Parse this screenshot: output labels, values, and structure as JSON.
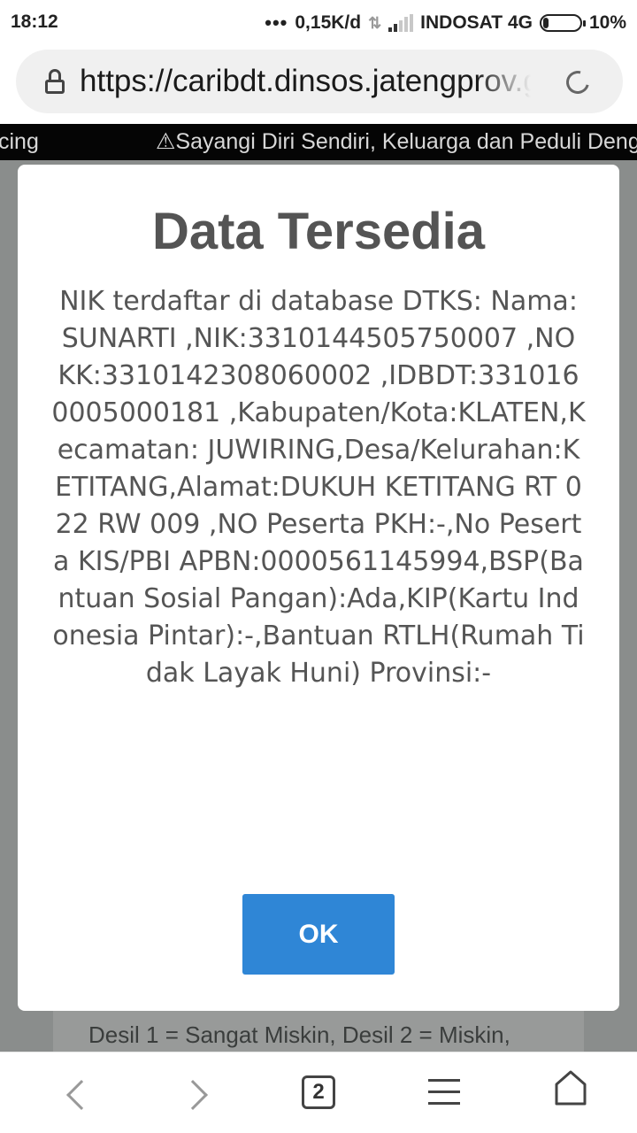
{
  "status_bar": {
    "time": "18:12",
    "network_speed": "0,15K/d",
    "carrier": "INDOSAT 4G",
    "battery": "10%"
  },
  "browser": {
    "url": "https://caribdt.dinsos.jatengprov.go.id",
    "tab_count": "2"
  },
  "page": {
    "marquee_left_fragment": "cing",
    "marquee_text": "Sayangi Diri Sendiri, Keluarga dan Peduli Dengan Sesama",
    "background_text": "Desil 1 = Sangat Miskin, Desil 2 = Miskin,"
  },
  "modal": {
    "title": "Data Tersedia",
    "body": "NIK terdaftar di database DTKS: Nama:SUNARTI ,NIK:3310144505750007 ,NO KK:3310142308060002 ,IDBDT:3310160005000181 ,Kabupaten/Kota:KLATEN,Kecamatan: JUWIRING,Desa/Kelurahan:KETITANG,Alamat:DUKUH KETITANG RT 022 RW 009 ,NO Peserta PKH:-,No Peserta KIS/PBI APBN:0000561145994,BSP(Bantuan Sosial Pangan):Ada,KIP(Kartu Indonesia Pintar):-,Bantuan RTLH(Rumah Tidak Layak Huni) Provinsi:-",
    "ok_label": "OK"
  },
  "colors": {
    "ok_button": "#2f86d6",
    "title_text": "#545454",
    "overlay": "#8a8d8c"
  },
  "icons": [
    "lock-icon",
    "reload-icon",
    "warning-icon",
    "back-icon",
    "forward-icon",
    "tabs-icon",
    "menu-icon",
    "home-icon"
  ]
}
